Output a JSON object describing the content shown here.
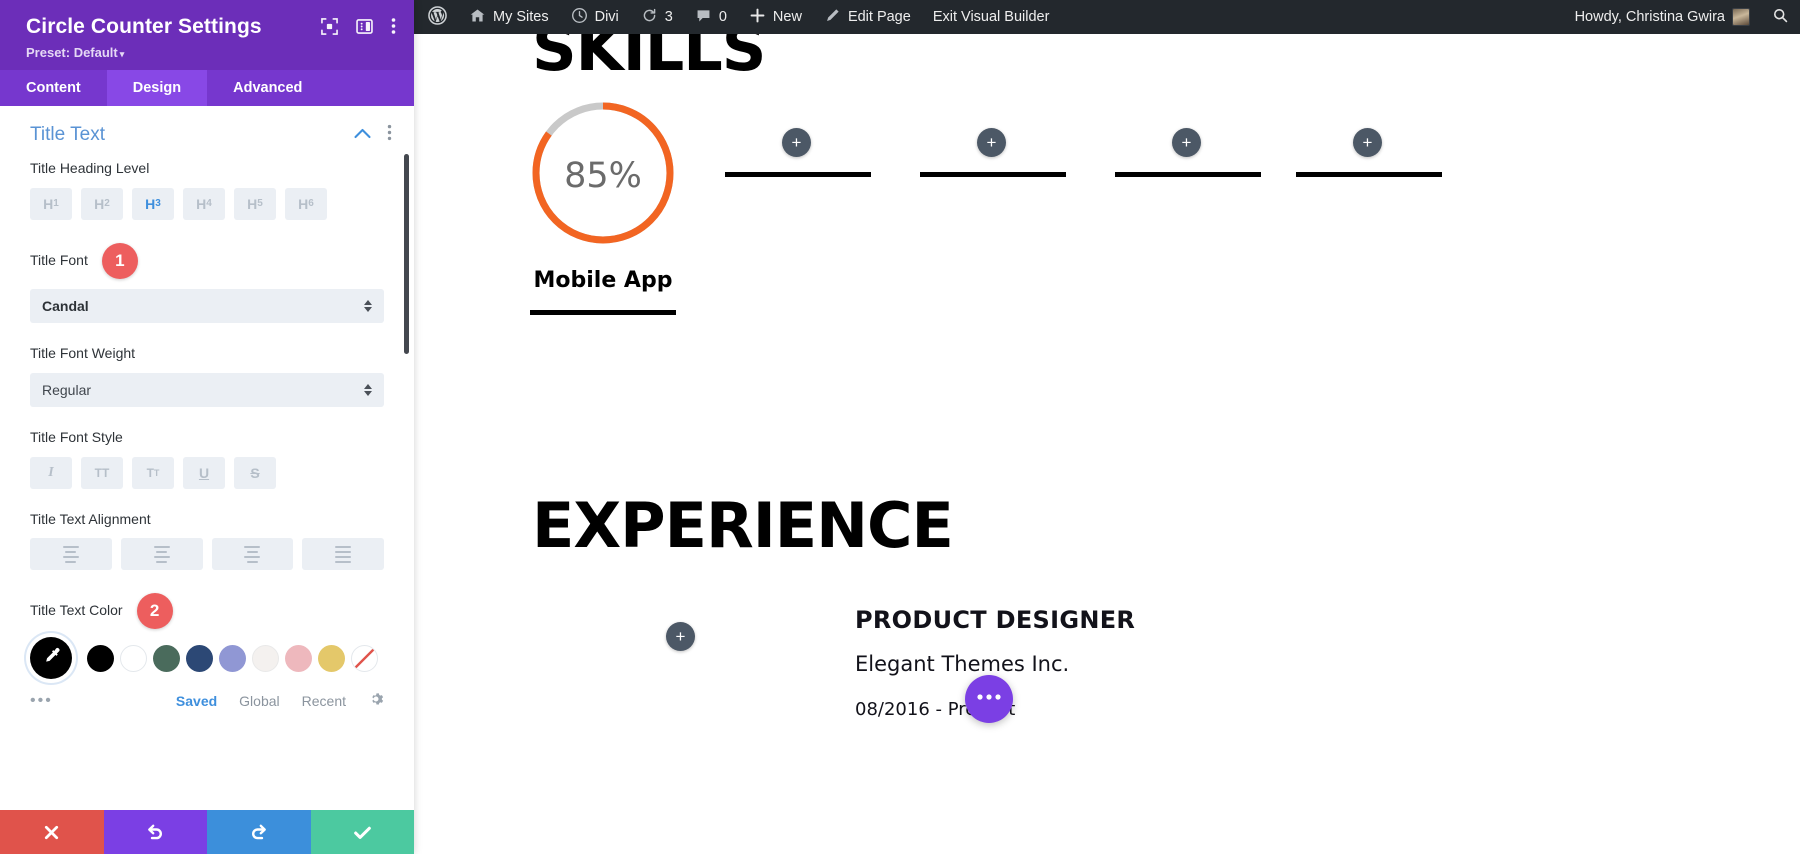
{
  "panel": {
    "title": "Circle Counter Settings",
    "preset_label": "Preset: Default",
    "preset_caret": "▾",
    "tabs": [
      {
        "label": "Content",
        "active": false
      },
      {
        "label": "Design",
        "active": true
      },
      {
        "label": "Advanced",
        "active": false
      }
    ],
    "section": {
      "title": "Title Text",
      "collapse_icon": "chevron-up-icon",
      "more_icon": "kebab-menu-icon"
    },
    "fields": {
      "heading_level": {
        "label": "Title Heading Level",
        "options": [
          "H1",
          "H2",
          "H3",
          "H4",
          "H5",
          "H6"
        ],
        "selected": "H3"
      },
      "title_font": {
        "label": "Title Font",
        "badge": "1",
        "value": "Candal"
      },
      "title_font_weight": {
        "label": "Title Font Weight",
        "value": "Regular"
      },
      "title_font_style": {
        "label": "Title Font Style",
        "options": [
          "I",
          "TT",
          "Tᴛ",
          "U",
          "S"
        ],
        "selected": null
      },
      "title_text_alignment": {
        "label": "Title Text Alignment",
        "options": [
          "align-left",
          "align-center",
          "align-right",
          "align-justify"
        ],
        "selected": null
      },
      "title_text_color": {
        "label": "Title Text Color",
        "badge": "2",
        "selected_swatch": "#000000",
        "selected_icon": "eyedropper-icon",
        "swatches": [
          "#000000",
          "#ffffff",
          "#4a6b5c",
          "#2c4875",
          "#9097d4",
          "#f4f1ef",
          "#eeb8bd",
          "#e4c86a",
          "none"
        ],
        "more_icon": "more-options-icon",
        "links": [
          {
            "label": "Saved",
            "active": true
          },
          {
            "label": "Global",
            "active": false
          },
          {
            "label": "Recent",
            "active": false
          }
        ],
        "settings_icon": "gear-icon"
      }
    },
    "footer": [
      {
        "name": "cancel",
        "icon": "✕",
        "color": "#E0534B"
      },
      {
        "name": "undo",
        "icon": "↺",
        "color": "#7B3FE4"
      },
      {
        "name": "redo",
        "icon": "↻",
        "color": "#3C8FDB"
      },
      {
        "name": "save",
        "icon": "✓",
        "color": "#4CC9A0"
      }
    ]
  },
  "adminbar": {
    "items": [
      {
        "id": "wp-logo",
        "label": "",
        "icon": "wordpress-logo-icon"
      },
      {
        "id": "my-sites",
        "label": "My Sites",
        "icon": "sites-icon"
      },
      {
        "id": "divi",
        "label": "Divi",
        "icon": "divi-icon"
      },
      {
        "id": "updates",
        "label": "3",
        "icon": "updates-icon"
      },
      {
        "id": "comments",
        "label": "0",
        "icon": "comment-icon"
      },
      {
        "id": "new",
        "label": "New",
        "icon": "plus-icon"
      },
      {
        "id": "edit-page",
        "label": "Edit Page",
        "icon": "pencil-icon"
      },
      {
        "id": "exit-visual-builder",
        "label": "Exit Visual Builder",
        "icon": ""
      }
    ],
    "howdy": "Howdy, Christina Gwira",
    "search_icon": "search-icon"
  },
  "canvas": {
    "skills_heading": "SKILLS",
    "circle_counter": {
      "percent": "85%",
      "label": "Mobile App",
      "bar_color": "#F26522",
      "track_color": "#C9C9C9",
      "value": 85
    },
    "experience_heading": "EXPERIENCE",
    "job": {
      "title": "PRODUCT DESIGNER",
      "company": "Elegant Themes Inc.",
      "dates": "08/2016 - Present"
    },
    "add_buttons": [
      "+",
      "+",
      "+",
      "+",
      "+"
    ],
    "fab_icon": "ellipsis-icon"
  }
}
